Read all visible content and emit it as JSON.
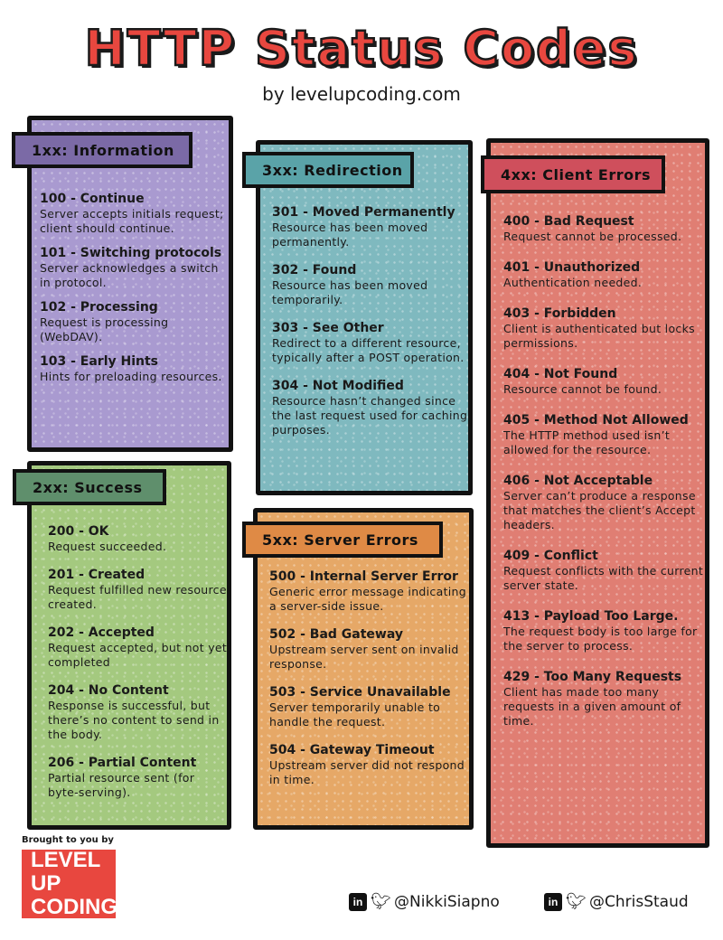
{
  "title": "HTTP Status Codes",
  "subtitle": "by levelupcoding.com",
  "colors": {
    "title": "#e8473f",
    "info_panel": "#a99ad0",
    "info_header": "#7b6aa6",
    "success_panel": "#a4c97f",
    "success_header": "#5f8f6c",
    "redirect_panel": "#7fb9bf",
    "redirect_header": "#5aa3a8",
    "server_panel": "#e6a867",
    "server_header": "#df8a45",
    "client_panel": "#e07e73",
    "client_header": "#cf4f5c"
  },
  "groups": {
    "info": {
      "header": "1xx: Information",
      "items": [
        {
          "code": "100 - Continue",
          "desc": "Server accepts initials request; client should continue."
        },
        {
          "code": "101 - Switching protocols",
          "desc": "Server acknowledges a switch in protocol."
        },
        {
          "code": "102 - Processing",
          "desc": "Request is processing (WebDAV)."
        },
        {
          "code": "103 - Early Hints",
          "desc": "Hints for preloading resources."
        }
      ]
    },
    "success": {
      "header": "2xx: Success",
      "items": [
        {
          "code": "200 - OK",
          "desc": "Request succeeded."
        },
        {
          "code": "201 - Created",
          "desc": "Request fulfilled new resource created."
        },
        {
          "code": "202 - Accepted",
          "desc": "Request accepted, but not yet completed"
        },
        {
          "code": "204 - No Content",
          "desc": "Response is successful, but there’s no content to send in the body."
        },
        {
          "code": "206 - Partial Content",
          "desc": "Partial resource sent (for byte-serving)."
        }
      ]
    },
    "redirect": {
      "header": "3xx: Redirection",
      "items": [
        {
          "code": "301 - Moved Permanently",
          "desc": "Resource has been moved permanently."
        },
        {
          "code": "302 - Found",
          "desc": "Resource has been moved temporarily."
        },
        {
          "code": "303 - See Other",
          "desc": "Redirect to a different resource, typically after a POST operation."
        },
        {
          "code": "304 - Not Modified",
          "desc": "Resource hasn’t changed since the last request used for caching purposes."
        }
      ]
    },
    "server": {
      "header": "5xx: Server Errors",
      "items": [
        {
          "code": "500 - Internal Server Error",
          "desc": "Generic error message indicating a server-side issue."
        },
        {
          "code": "502 - Bad Gateway",
          "desc": "Upstream server sent on invalid response."
        },
        {
          "code": "503 - Service Unavailable",
          "desc": "Server temporarily unable to handle the request."
        },
        {
          "code": "504 - Gateway Timeout",
          "desc": "Upstream server did not respond in time."
        }
      ]
    },
    "client": {
      "header": "4xx: Client Errors",
      "items": [
        {
          "code": "400 - Bad Request",
          "desc": "Request cannot be processed."
        },
        {
          "code": "401 - Unauthorized",
          "desc": "Authentication needed."
        },
        {
          "code": "403 - Forbidden",
          "desc": "Client is authenticated but locks permissions."
        },
        {
          "code": "404 - Not Found",
          "desc": "Resource cannot be found."
        },
        {
          "code": "405 - Method Not Allowed",
          "desc": "The HTTP method used isn’t allowed for the resource."
        },
        {
          "code": "406 - Not Acceptable",
          "desc": "Server can’t produce a response that matches the client’s Accept headers."
        },
        {
          "code": "409 - Conflict",
          "desc": "Request conflicts with the current server state."
        },
        {
          "code": "413 - Payload Too Large.",
          "desc": "The request body is too large for the server to process."
        },
        {
          "code": "429 - Too Many Requests",
          "desc": "Client has made too many requests in a given amount of time."
        }
      ]
    }
  },
  "footer": {
    "brought": "Brought to you by",
    "logo_line1": "LEVEL UP",
    "logo_line2": "CODING",
    "social": [
      {
        "handle": "@NikkiSiapno",
        "icons": [
          "linkedin-icon",
          "twitter-icon"
        ]
      },
      {
        "handle": "@ChrisStaud",
        "icons": [
          "linkedin-icon",
          "twitter-icon"
        ]
      }
    ]
  }
}
